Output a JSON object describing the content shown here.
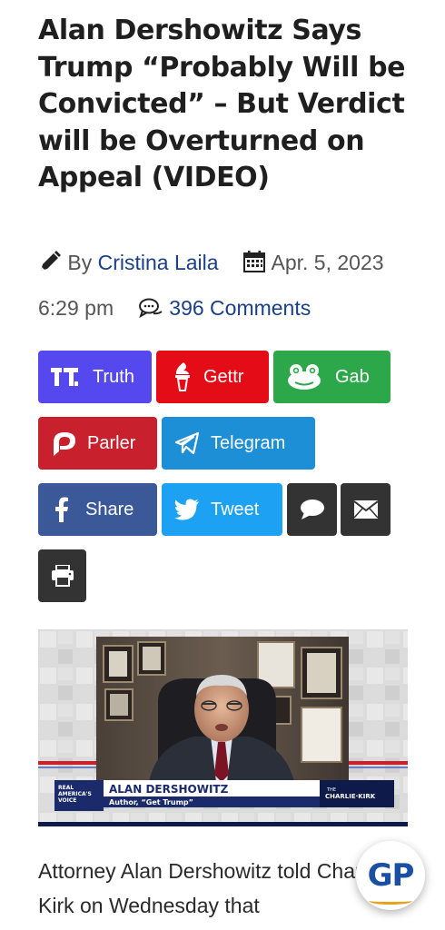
{
  "article": {
    "headline": "Alan Dershowitz Says Trump “Probably Will be Convicted” – But Verdict will be Overturned on Appeal (VIDEO)",
    "by_prefix": "By",
    "author": "Cristina Laila",
    "date": "Apr. 5, 2023 6:29 pm",
    "comments": "396 Comments",
    "body": "Attorney Alan Dershowitz told Charlie Kirk on Wednesday that"
  },
  "share": {
    "truth": "Truth",
    "gettr": "Gettr",
    "gab": "Gab",
    "parler": "Parler",
    "telegram": "Telegram",
    "facebook": "Share",
    "twitter": "Tweet"
  },
  "video": {
    "lower_third_name": "ALAN DERSHOWITZ",
    "lower_third_sub": "Author, “Get Trump”",
    "network_logo": "REAL AMERICA'S VOICE",
    "show_logo": "THE CHARLIE KIRK SHOW"
  },
  "badge": {
    "text": "GP"
  },
  "colors": {
    "truth": "#5448ee",
    "gettr": "#e40c16",
    "gab": "#2ca84a",
    "parler": "#c8202c",
    "telegram": "#1d8fd6",
    "facebook": "#3b5998",
    "twitter": "#1da1f2",
    "dark": "#333333",
    "link": "#1a3f8b"
  }
}
